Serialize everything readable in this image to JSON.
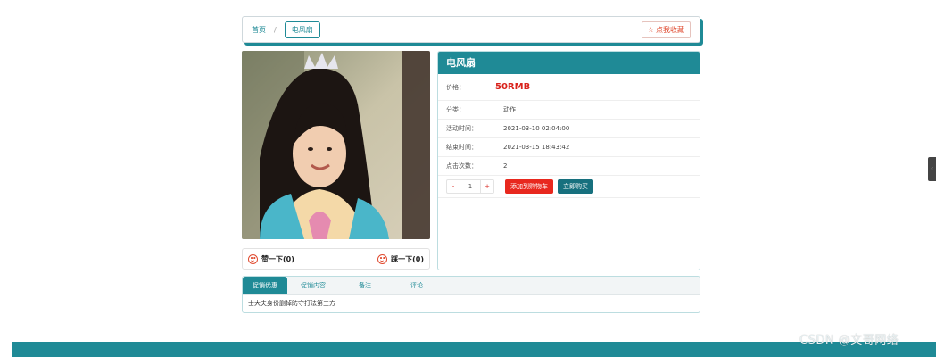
{
  "breadcrumb": {
    "home": "首页",
    "separator": "/",
    "current": "电风扇"
  },
  "favorite": {
    "label": "点我收藏",
    "icon": "star-icon"
  },
  "vote": {
    "like": "赞一下(0)",
    "dislike": "踩一下(0)",
    "icon": "smile-icon"
  },
  "product": {
    "title": "电风扇",
    "price_label": "价格：",
    "price": "50RMB",
    "fields": [
      {
        "label": "分类：",
        "value": "动作"
      },
      {
        "label": "活动时间：",
        "value": "2021-03-10 02:04:00"
      },
      {
        "label": "结束时间：",
        "value": "2021-03-15 18:43:42"
      },
      {
        "label": "点击次数：",
        "value": "2"
      }
    ],
    "quantity": {
      "minus": "-",
      "value": "1",
      "plus": "+"
    },
    "add_to_cart": "添加到购物车",
    "buy_now": "立即购买"
  },
  "tabs": [
    {
      "label": "促销优惠",
      "active": true
    },
    {
      "label": "促销内容",
      "active": false
    },
    {
      "label": "备注",
      "active": false
    },
    {
      "label": "评论",
      "active": false
    }
  ],
  "tab_content": "士大夫身份删掉防守打法第三方",
  "side_handle": "‹",
  "watermark": "CSDN @文哥网络",
  "colors": {
    "accent": "#1f8a96",
    "price": "#d9231c",
    "cart": "#e8281e",
    "buy": "#17707e"
  }
}
